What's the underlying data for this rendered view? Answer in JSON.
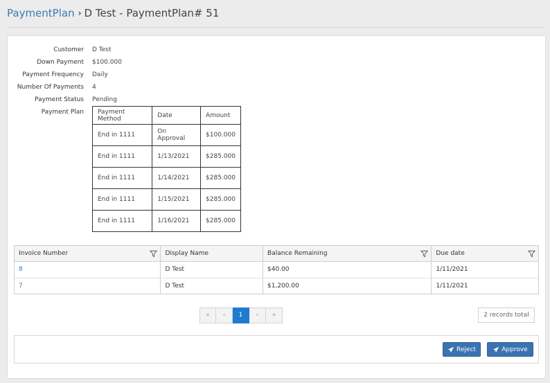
{
  "breadcrumb": {
    "parent": "PaymentPlan",
    "current": "D Test - PaymentPlan# 51"
  },
  "details": [
    {
      "label": "Customer",
      "value": "D Test"
    },
    {
      "label": "Down Payment",
      "value": "$100.000"
    },
    {
      "label": "Payment Frequency",
      "value": "Daily"
    },
    {
      "label": "Number Of Payments",
      "value": "4"
    },
    {
      "label": "Payment Status",
      "value": "Pending"
    },
    {
      "label": "Payment Plan",
      "value": ""
    }
  ],
  "plan_table": {
    "headers": [
      "Payment Method",
      "Date",
      "Amount"
    ],
    "rows": [
      [
        "End in 1111",
        "On Approval",
        "$100.000"
      ],
      [
        "End in 1111",
        "1/13/2021",
        "$285.000"
      ],
      [
        "End in 1111",
        "1/14/2021",
        "$285.000"
      ],
      [
        "End in 1111",
        "1/15/2021",
        "$285.000"
      ],
      [
        "End in 1111",
        "1/16/2021",
        "$285.000"
      ]
    ]
  },
  "invoice_grid": {
    "headers": [
      "Invoice Number",
      "Display Name",
      "Balance Remaining",
      "Due date"
    ],
    "rows": [
      [
        "8",
        "D Test",
        "$40.00",
        "1/11/2021"
      ],
      [
        "7",
        "D Test",
        "$1,200.00",
        "1/11/2021"
      ]
    ]
  },
  "pager": {
    "first": "«",
    "prev": "‹",
    "page": "1",
    "next": "›",
    "last": "»"
  },
  "records_total": "2 records total",
  "buttons": {
    "reject": "Reject",
    "approve": "Approve"
  },
  "colors": {
    "accent": "#3a7ab8",
    "button": "#3b73b0",
    "active_page": "#1e7bd0"
  },
  "icons": {
    "filter": "filter-icon",
    "send": "paper-plane-icon",
    "separator": "chevron-right-icon"
  }
}
